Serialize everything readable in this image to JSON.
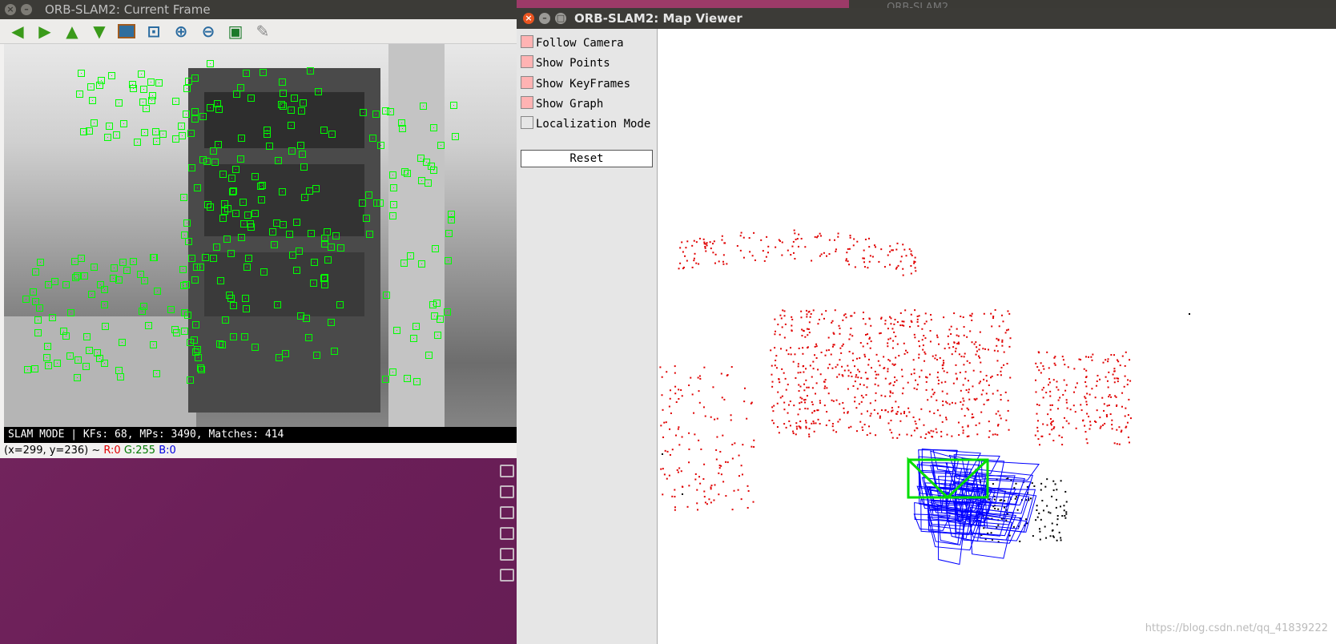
{
  "background": {
    "other_window_title": "… ORB-SLAM2"
  },
  "current_frame": {
    "title": "ORB-SLAM2: Current Frame",
    "toolbar": [
      "arrow-left-icon",
      "arrow-right-icon",
      "arrow-up-icon",
      "arrow-down-icon",
      "image-icon",
      "zoom-fit-icon",
      "zoom-in-icon",
      "zoom-out-icon",
      "save-icon",
      "brush-icon"
    ],
    "status": "SLAM MODE |  KFs: 68, MPs: 3490, Matches: 414",
    "coords": "(x=299, y=236) ~",
    "r": "R:0",
    "g": "G:255",
    "b": "B:0",
    "feature_color": "#00ff00"
  },
  "map_viewer": {
    "title": "ORB-SLAM2: Map Viewer",
    "follow_camera": "Follow Camera",
    "show_points": "Show Points",
    "show_keyframes": "Show KeyFrames",
    "show_graph": "Show Graph",
    "localization_mode": "Localization Mode",
    "reset": "Reset",
    "point_color": "#e00000",
    "keyframe_color": "#0000ff",
    "current_camera_color": "#00dd00",
    "watermark": "https://blog.csdn.net/qq_41839222"
  }
}
